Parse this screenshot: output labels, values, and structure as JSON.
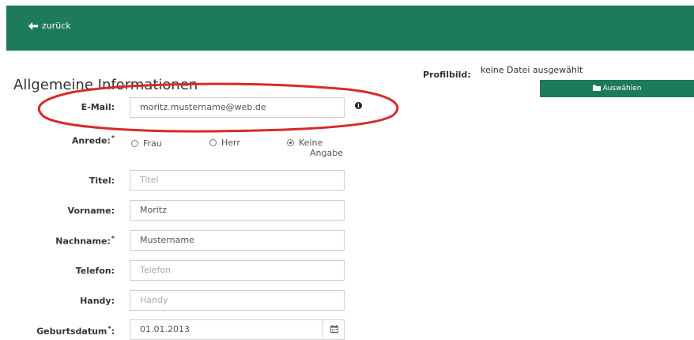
{
  "header": {
    "back_label": "zurück",
    "color": "#1d7a5c"
  },
  "section_title": "Allgemeine Informationen",
  "form": {
    "email": {
      "label": "E-Mail:",
      "value": "moritz.mustername@web.de"
    },
    "anrede": {
      "label": "Anrede:",
      "required": "*",
      "options": [
        "Frau",
        "Herr",
        "Keine Angabe"
      ],
      "selected": "Keine Angabe",
      "option_keine_line1": "Keine",
      "option_keine_line2": "Angabe"
    },
    "titel": {
      "label": "Titel:",
      "placeholder": "Titel"
    },
    "vorname": {
      "label": "Vorname:",
      "value": "Moritz"
    },
    "nachname": {
      "label": "Nachname:",
      "required": "*",
      "value": "Mustername"
    },
    "telefon": {
      "label": "Telefon:",
      "placeholder": "Telefon"
    },
    "handy": {
      "label": "Handy:",
      "placeholder": "Handy"
    },
    "geburtsdatum": {
      "label": "Geburtsdatum",
      "required": "*",
      "colon": ":",
      "value": "01.01.2013"
    }
  },
  "profile": {
    "label": "Profilbild:",
    "no_file": "keine Datei ausgewählt",
    "button_label": "Auswählen"
  },
  "icons": {
    "back": "arrow-left-icon",
    "info": "info-icon",
    "calendar": "calendar-icon",
    "folder": "folder-icon"
  },
  "annotation_color": "#d62b2b"
}
